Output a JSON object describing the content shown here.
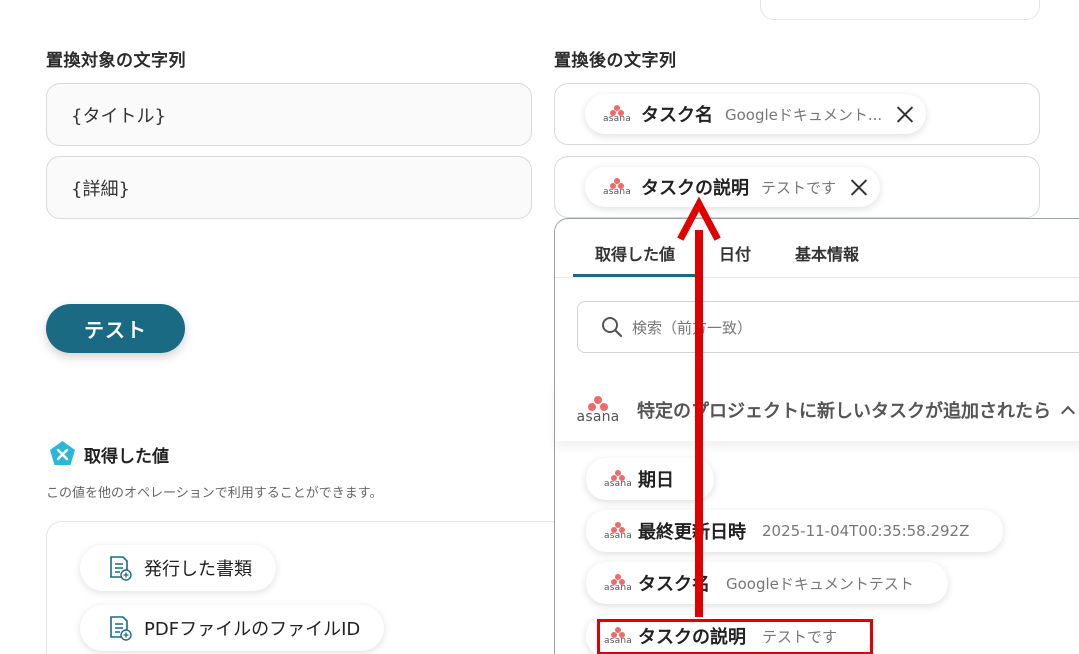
{
  "left": {
    "label": "置換対象の文字列",
    "fields": [
      "{タイトル}",
      "{詳細}"
    ],
    "test_button": "テスト"
  },
  "right": {
    "label": "置換後の文字列",
    "chips": [
      {
        "name": "タスク名",
        "value": "Googleドキュメント..."
      },
      {
        "name": "タスクの説明",
        "value": "テストです"
      }
    ]
  },
  "asana_logo_text": "asana",
  "acquired": {
    "title": "取得した値",
    "description": "この値を他のオペレーションで利用することができます。",
    "items": [
      "発行した書類",
      "PDFファイルのファイルID"
    ]
  },
  "panel": {
    "tabs": [
      "取得した値",
      "日付",
      "基本情報"
    ],
    "search_placeholder": "検索（前方一致）",
    "group_title": "特定のプロジェクトに新しいタスクが追加されたら",
    "items": [
      {
        "name": "期日",
        "value": ""
      },
      {
        "name": "最終更新日時",
        "value": "2025-11-04T00:35:58.292Z"
      },
      {
        "name": "タスク名",
        "value": "Googleドキュメントテスト"
      },
      {
        "name": "タスクの説明",
        "value": "テストです"
      }
    ]
  },
  "colors": {
    "accent": "#1a6a84",
    "highlight": "#e00000",
    "asana": "#f06a6a",
    "acquired_icon": "#2bb7d8"
  },
  "icons": {
    "chip_remove": "close-icon",
    "search": "search-icon",
    "group_toggle": "chevron-up-icon",
    "acquired": "yoom-acquired-icon",
    "document": "document-icon"
  }
}
